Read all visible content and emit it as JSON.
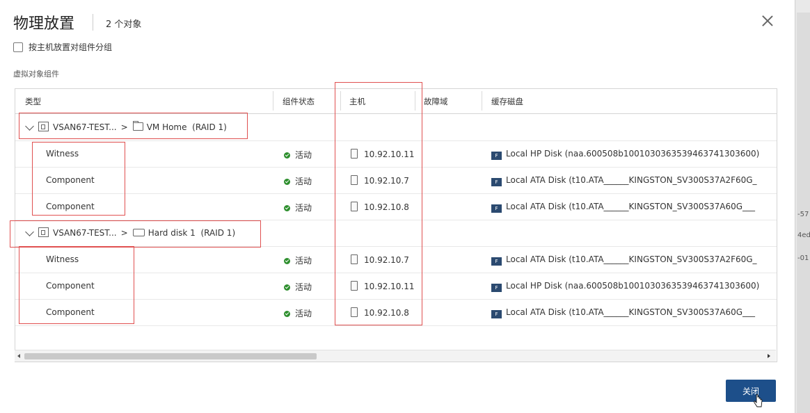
{
  "dialog": {
    "title": "物理放置",
    "subtitle": "2 个对象",
    "group_by_host_label": "按主机放置对组件分组",
    "section_label": "虚拟对象组件",
    "close_button": "关闭"
  },
  "table": {
    "columns": [
      "类型",
      "组件状态",
      "主机",
      "故障域",
      "缓存磁盘"
    ],
    "groups": [
      {
        "vm": "VSAN67-TEST...",
        "object": "VM Home",
        "raid": "(RAID 1)",
        "icon": "folder-icon",
        "rows": [
          {
            "type": "Witness",
            "status": "活动",
            "host": "10.92.10.11",
            "disk": "Local HP Disk (naa.600508b1001030363539463741303600)"
          },
          {
            "type": "Component",
            "status": "活动",
            "host": "10.92.10.7",
            "disk": "Local ATA Disk (t10.ATA______KINGSTON_SV300S37A2F60G_"
          },
          {
            "type": "Component",
            "status": "活动",
            "host": "10.92.10.8",
            "disk": "Local ATA Disk (t10.ATA______KINGSTON_SV300S37A60G___"
          }
        ]
      },
      {
        "vm": "VSAN67-TEST...",
        "object": "Hard disk 1",
        "raid": "(RAID 1)",
        "icon": "hard-disk-icon",
        "rows": [
          {
            "type": "Witness",
            "status": "活动",
            "host": "10.92.10.7",
            "disk": "Local ATA Disk (t10.ATA______KINGSTON_SV300S37A2F60G_"
          },
          {
            "type": "Component",
            "status": "活动",
            "host": "10.92.10.11",
            "disk": "Local HP Disk (naa.600508b1001030363539463741303600)"
          },
          {
            "type": "Component",
            "status": "活动",
            "host": "10.92.10.8",
            "disk": "Local ATA Disk (t10.ATA______KINGSTON_SV300S37A60G___"
          }
        ]
      }
    ]
  },
  "background_fragments": [
    "-57",
    "4ed",
    "-01"
  ],
  "colors": {
    "primary_button": "#1d4f8a",
    "status_active": "#2e8f2e",
    "highlight_box": "#e05050",
    "disk_badge": "#2b4a70"
  }
}
